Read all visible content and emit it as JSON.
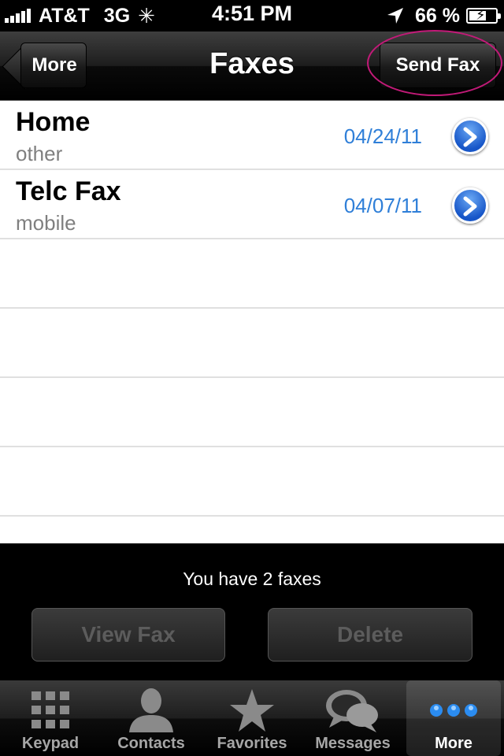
{
  "status_bar": {
    "carrier": "AT&T",
    "network": "3G",
    "time": "4:51 PM",
    "battery_percent": "66 %",
    "battery_level": 0.66
  },
  "nav": {
    "back_label": "More",
    "title": "Faxes",
    "send_label": "Send Fax"
  },
  "faxes": [
    {
      "name": "Home",
      "type": "other",
      "date": "04/24/11"
    },
    {
      "name": "Telc Fax",
      "type": "mobile",
      "date": "04/07/11"
    }
  ],
  "toolbar": {
    "count_text": "You have 2 faxes",
    "view_label": "View Fax",
    "delete_label": "Delete"
  },
  "tabs": [
    {
      "label": "Keypad",
      "icon": "keypad-icon"
    },
    {
      "label": "Contacts",
      "icon": "contacts-icon"
    },
    {
      "label": "Favorites",
      "icon": "star-icon"
    },
    {
      "label": "Messages",
      "icon": "messages-icon"
    },
    {
      "label": "More",
      "icon": "more-icon",
      "selected": true
    }
  ],
  "colors": {
    "date_blue": "#2f7fd8",
    "highlight_ring": "#c21a78",
    "disclosure_blue": "#1756c8"
  }
}
